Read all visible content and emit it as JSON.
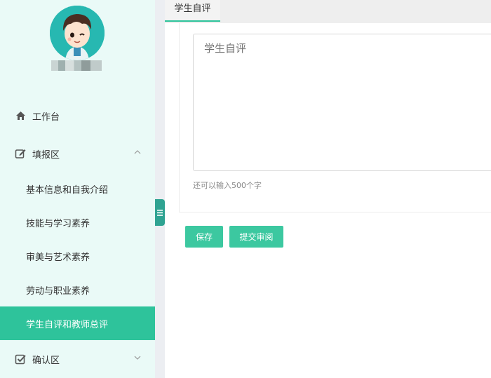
{
  "sidebar": {
    "items": [
      {
        "label": "工作台",
        "icon": "home-icon"
      },
      {
        "label": "填报区",
        "icon": "edit-icon",
        "expanded": true
      },
      {
        "label": "确认区",
        "icon": "checkbox-icon",
        "expanded": false
      }
    ],
    "sub_items": [
      {
        "label": "基本信息和自我介绍"
      },
      {
        "label": "技能与学习素养"
      },
      {
        "label": "审美与艺术素养"
      },
      {
        "label": "劳动与职业素养"
      },
      {
        "label": "学生自评和教师总评",
        "active": true
      }
    ]
  },
  "tabs": [
    {
      "label": "学生自评",
      "active": true
    }
  ],
  "form": {
    "textarea_placeholder": "学生自评",
    "textarea_value": "",
    "hint": "还可以输入500个字",
    "save_label": "保存",
    "submit_label": "提交审阅"
  },
  "colors": {
    "accent": "#2ec39b",
    "sidebar_bg": "#eafaf7",
    "button": "#3cc8a0",
    "handle": "#2fa392"
  }
}
